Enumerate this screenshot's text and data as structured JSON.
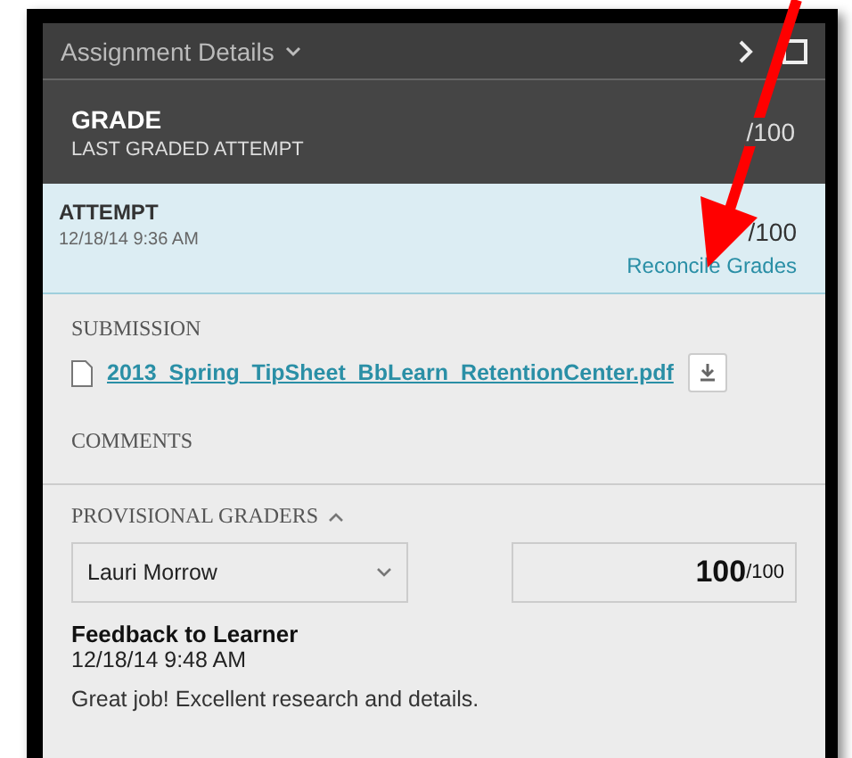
{
  "panel": {
    "title": "Assignment Details"
  },
  "grade": {
    "title": "GRADE",
    "subtitle": "LAST GRADED ATTEMPT",
    "value": "/100"
  },
  "attempt": {
    "title": "ATTEMPT",
    "date": "12/18/14 9:36 AM",
    "value": "/100",
    "link": "Reconcile Grades"
  },
  "submission": {
    "heading": "SUBMISSION",
    "file": "2013_Spring_TipSheet_BbLearn_RetentionCenter.pdf"
  },
  "comments": {
    "heading": "COMMENTS"
  },
  "provisional": {
    "heading": "PROVISIONAL GRADERS",
    "expanded": true,
    "grader": "Lauri Morrow",
    "score": "100",
    "out_of": "/100",
    "feedback_title": "Feedback to Learner",
    "feedback_date": "12/18/14 9:48 AM",
    "feedback": "Great job! Excellent research and details."
  }
}
